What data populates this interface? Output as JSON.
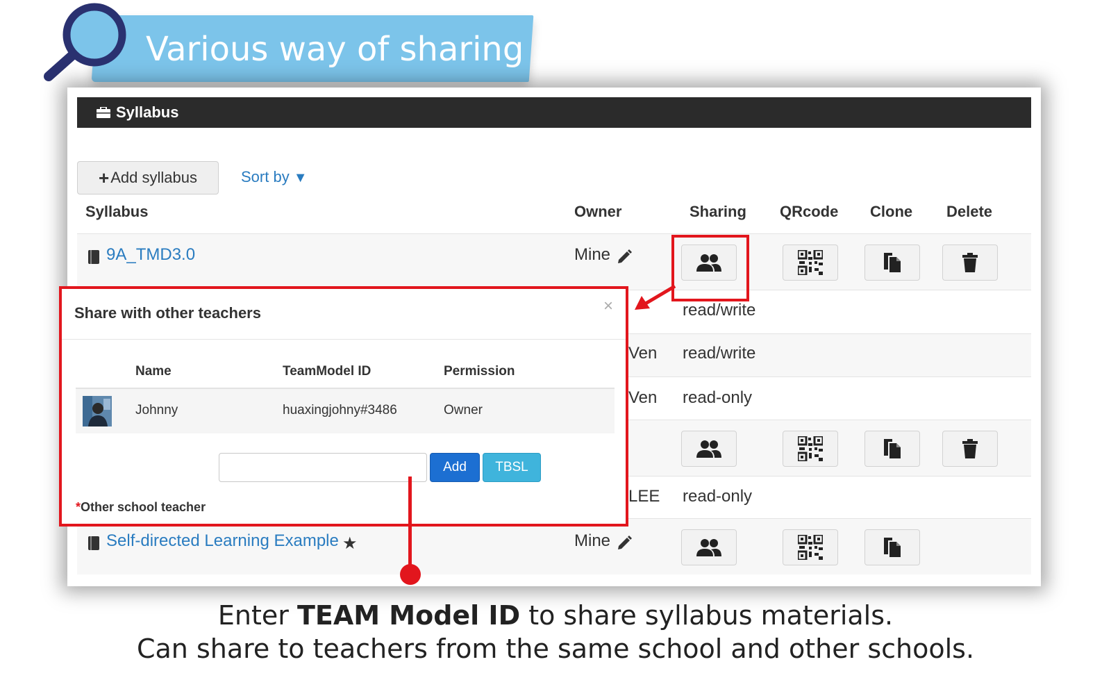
{
  "banner": {
    "title": "Various way of sharing"
  },
  "panel": {
    "header_title": "Syllabus",
    "add_button_label": "Add syllabus",
    "sort_label": "Sort by",
    "columns": {
      "syllabus": "Syllabus",
      "owner": "Owner",
      "sharing": "Sharing",
      "qrcode": "QRcode",
      "clone": "Clone",
      "delete": "Delete"
    },
    "rows": [
      {
        "name": "9A_TMD3.0",
        "owner": "Mine"
      },
      {
        "permission": "read/write"
      },
      {
        "owner_fragment": "Ven",
        "permission": "read/write"
      },
      {
        "owner_fragment": "Ven",
        "permission": "read-only"
      },
      {
        "owner_fragment": ""
      },
      {
        "owner_fragment": "LEE",
        "permission": "read-only"
      },
      {
        "name": "Self-directed Learning Example",
        "owner": "Mine"
      }
    ]
  },
  "modal": {
    "title": "Share with other teachers",
    "close": "×",
    "columns": {
      "name": "Name",
      "id": "TeamModel ID",
      "permission": "Permission"
    },
    "member": {
      "name": "Johnny",
      "id": "huaxingjohny#3486",
      "permission": "Owner"
    },
    "input_value": "",
    "add_label": "Add",
    "tbsl_label": "TBSL",
    "note_marker": "*",
    "note": "Other school teacher"
  },
  "caption": {
    "line1_pre": "Enter ",
    "line1_bold": "TEAM Model ID",
    "line1_post": " to share syllabus materials.",
    "line2": "Can share to teachers from the same school and other schools."
  },
  "colors": {
    "accent_red": "#e2161d",
    "link_blue": "#2a7cc0",
    "banner_blue": "#7cc4ea",
    "header_dark": "#2b2b2b"
  }
}
